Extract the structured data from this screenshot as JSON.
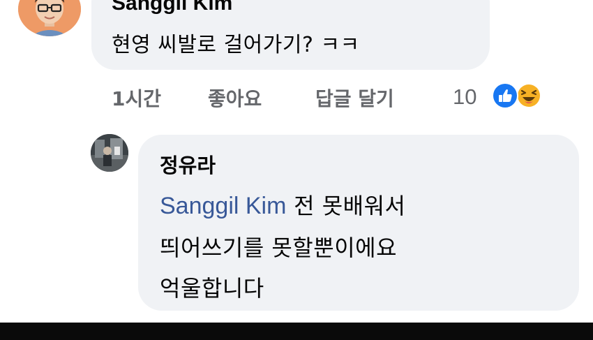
{
  "comment": {
    "author": "Sanggil Kim",
    "text": "현영 씨발로 걸어가기? ㅋㅋ",
    "time": "1시간",
    "like_label": "좋아요",
    "reply_label": "답글 달기",
    "reaction_count": "10",
    "reactions": [
      "like-icon",
      "haha-icon"
    ]
  },
  "reply": {
    "author": "정유라",
    "mention": "Sanggil Kim",
    "line1_rest": " 전 못배워서",
    "line2": "띄어쓰기를 못할뿐이에요",
    "line3": "억울합니다"
  },
  "colors": {
    "bubble": "#f0f2f5",
    "mention": "#385898",
    "meta": "#65676b",
    "like_blue": "#1877f2",
    "haha_yellow": "#f7b125"
  }
}
